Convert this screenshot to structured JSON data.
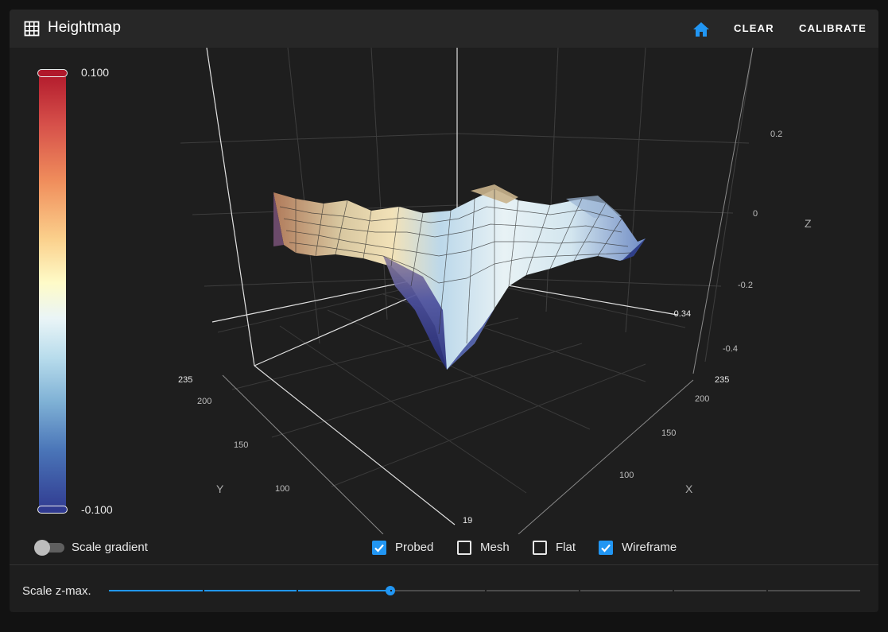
{
  "toolbar": {
    "title": "Heightmap",
    "title_icon": "grid-icon",
    "home_icon": "home-icon",
    "clear_label": "CLEAR",
    "calibrate_label": "CALIBRATE",
    "accent_color": "#2196f3"
  },
  "colorbar": {
    "max_label": "0.100",
    "min_label": "-0.100"
  },
  "axes": {
    "x_title": "X",
    "y_title": "Y",
    "z_title": "Z",
    "x_ticks": [
      "100",
      "150",
      "200",
      "235"
    ],
    "y_ticks": [
      "100",
      "150",
      "200",
      "235"
    ],
    "z_ticks": [
      "0.2",
      "0",
      "-0.2",
      "-0.4"
    ],
    "z_min_marker": "-0.34",
    "origin_label": "19"
  },
  "controls": {
    "scale_gradient_label": "Scale gradient",
    "scale_gradient_on": false,
    "probed_label": "Probed",
    "probed_checked": true,
    "mesh_label": "Mesh",
    "mesh_checked": false,
    "flat_label": "Flat",
    "flat_checked": false,
    "wireframe_label": "Wireframe",
    "wireframe_checked": true
  },
  "slider": {
    "label": "Scale z-max.",
    "value_fraction": 0.375,
    "tick_count": 8
  }
}
